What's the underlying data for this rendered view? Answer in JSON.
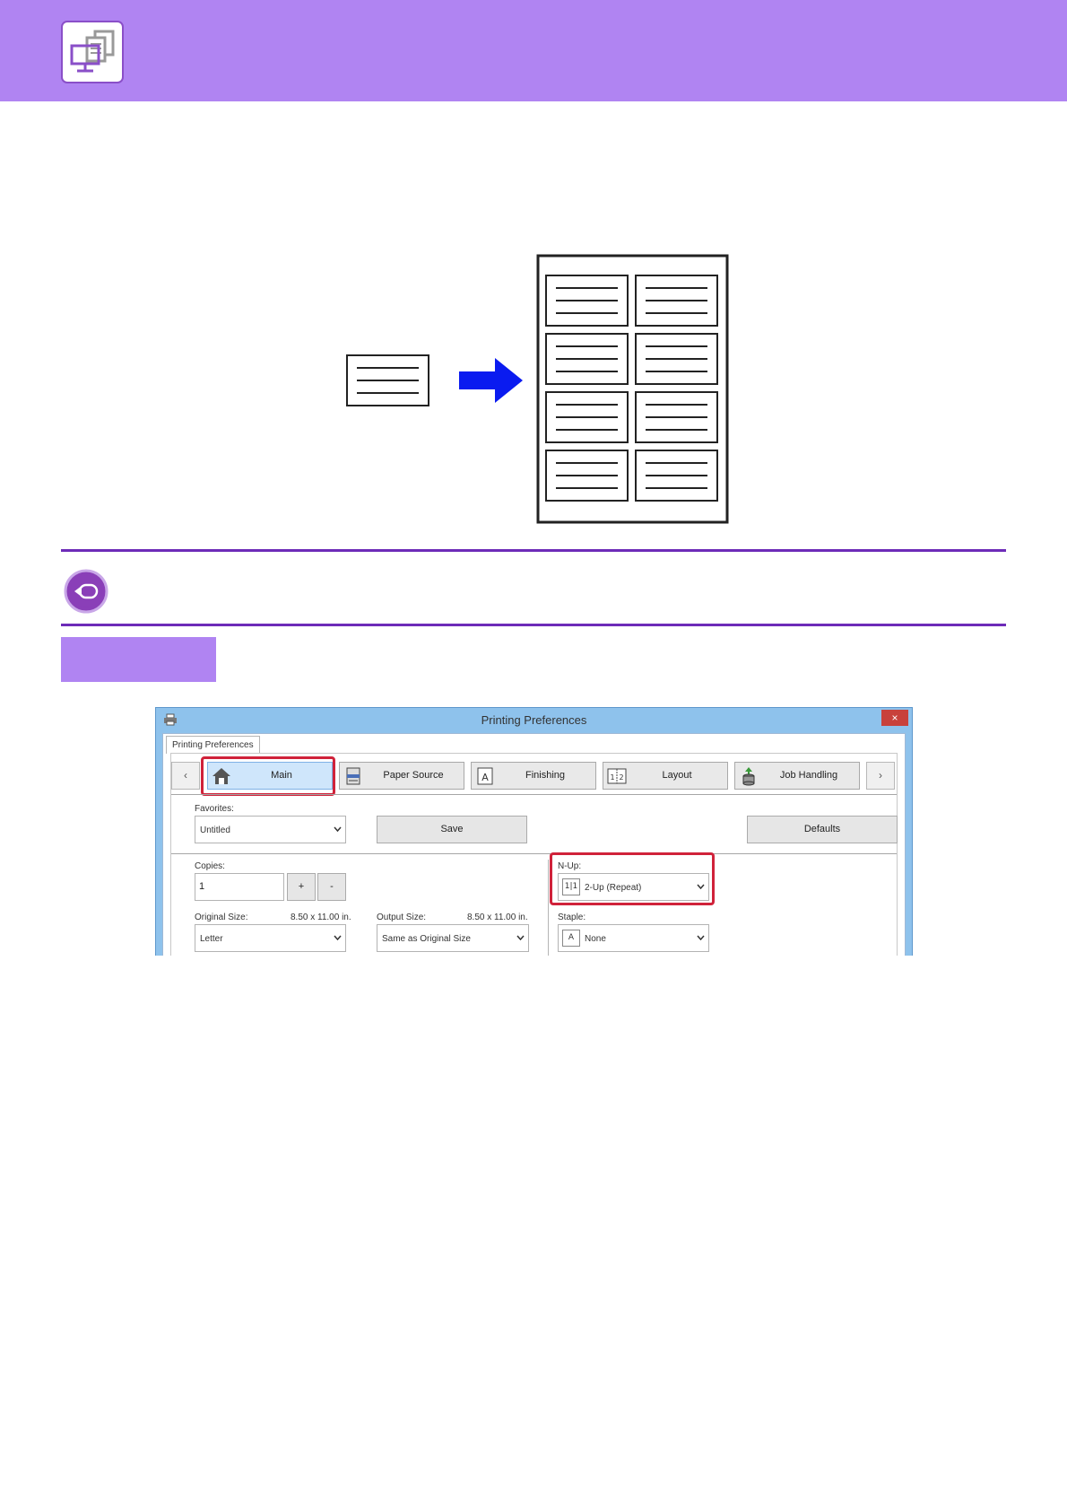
{
  "colors": {
    "header": "#b084f2",
    "rule": "#6d2bb8",
    "arrow": "#0a1bf0",
    "highlight": "#d0223a",
    "dialog_frame": "#8ec2ec"
  },
  "header": {
    "icon": "printer-driver-icon"
  },
  "note": {
    "icon": "back-arrow-icon"
  },
  "dialog": {
    "title": "Printing Preferences",
    "close_label": "×",
    "outer_tab": "Printing Preferences",
    "nav_prev": "‹",
    "nav_next": "›",
    "tabs": [
      {
        "label": "Main",
        "icon": "home-icon",
        "active": true
      },
      {
        "label": "Paper Source",
        "icon": "paper-tray-icon"
      },
      {
        "label": "Finishing",
        "icon": "finishing-icon"
      },
      {
        "label": "Layout",
        "icon": "layout-icon"
      },
      {
        "label": "Job Handling",
        "icon": "job-handling-icon"
      }
    ],
    "favorites": {
      "label": "Favorites:",
      "value": "Untitled"
    },
    "save_label": "Save",
    "defaults_label": "Defaults",
    "copies": {
      "label": "Copies:",
      "value": "1",
      "plus": "+",
      "minus": "-"
    },
    "original_size": {
      "label": "Original Size:",
      "dims": "8.50 x 11.00 in.",
      "value": "Letter"
    },
    "output_size": {
      "label": "Output Size:",
      "dims": "8.50 x 11.00 in.",
      "value": "Same as Original Size"
    },
    "nup": {
      "label": "N-Up:",
      "value": "2-Up (Repeat)",
      "icon_text": "1|1"
    },
    "staple": {
      "label": "Staple:",
      "value": "None",
      "icon_text": "A"
    }
  }
}
